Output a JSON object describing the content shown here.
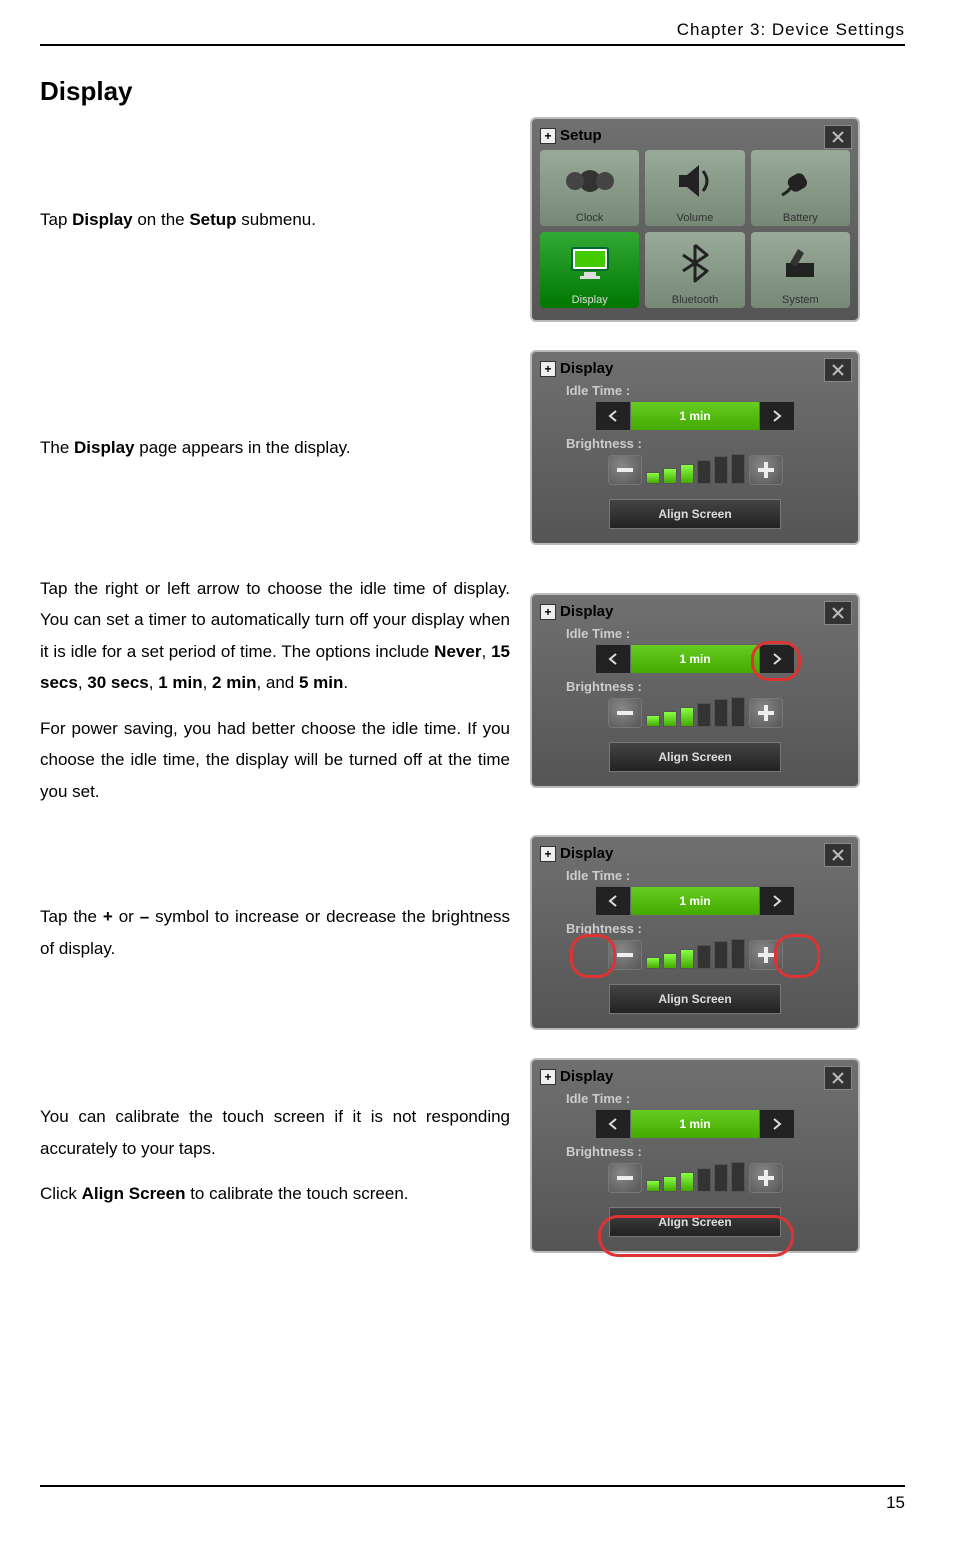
{
  "header": {
    "chapter": "Chapter 3: Device Settings"
  },
  "footer": {
    "page": "15"
  },
  "section_title": "Display",
  "setup_panel": {
    "title": "Setup",
    "tiles": [
      {
        "label": "Clock"
      },
      {
        "label": "Volume"
      },
      {
        "label": "Battery"
      },
      {
        "label": "Display"
      },
      {
        "label": "Bluetooth"
      },
      {
        "label": "System"
      }
    ]
  },
  "display_panel": {
    "title": "Display",
    "idle_label": "Idle Time :",
    "idle_value": "1 min",
    "brightness_label": "Brightness :",
    "align_label": "Align Screen"
  },
  "paragraphs": {
    "p1_pre": "Tap ",
    "p1_b1": "Display",
    "p1_mid": " on the ",
    "p1_b2": "Setup",
    "p1_post": " submenu.",
    "p2_pre": "The ",
    "p2_b": "Display",
    "p2_post": " page appears in the display.",
    "p3a_pre": "Tap the right or left arrow to choose the idle time of display. You can set a timer to automatically turn off your display when it is idle for a set period of time. The options include ",
    "p3a_b1": "Never",
    "p3a_c1": ", ",
    "p3a_b2": "15 secs",
    "p3a_c2": ", ",
    "p3a_b3": "30 secs",
    "p3a_c3": ", ",
    "p3a_b4": "1 min",
    "p3a_c4": ", ",
    "p3a_b5": "2 min",
    "p3a_c5": ", and ",
    "p3a_b6": "5 min",
    "p3a_c6": ".",
    "p3b": "For power saving, you had better choose the idle time. If you choose the idle time, the display will be turned off at the time you set.",
    "p4_pre": "Tap the ",
    "p4_b1": "+",
    "p4_mid": " or ",
    "p4_b2": "–",
    "p4_post": " symbol to increase or decrease the brightness of display.",
    "p5a": "You can calibrate the touch screen if it is not responding accurately to your taps.",
    "p5b_pre": "Click ",
    "p5b_b": "Align Screen",
    "p5b_post": " to calibrate the touch screen."
  }
}
